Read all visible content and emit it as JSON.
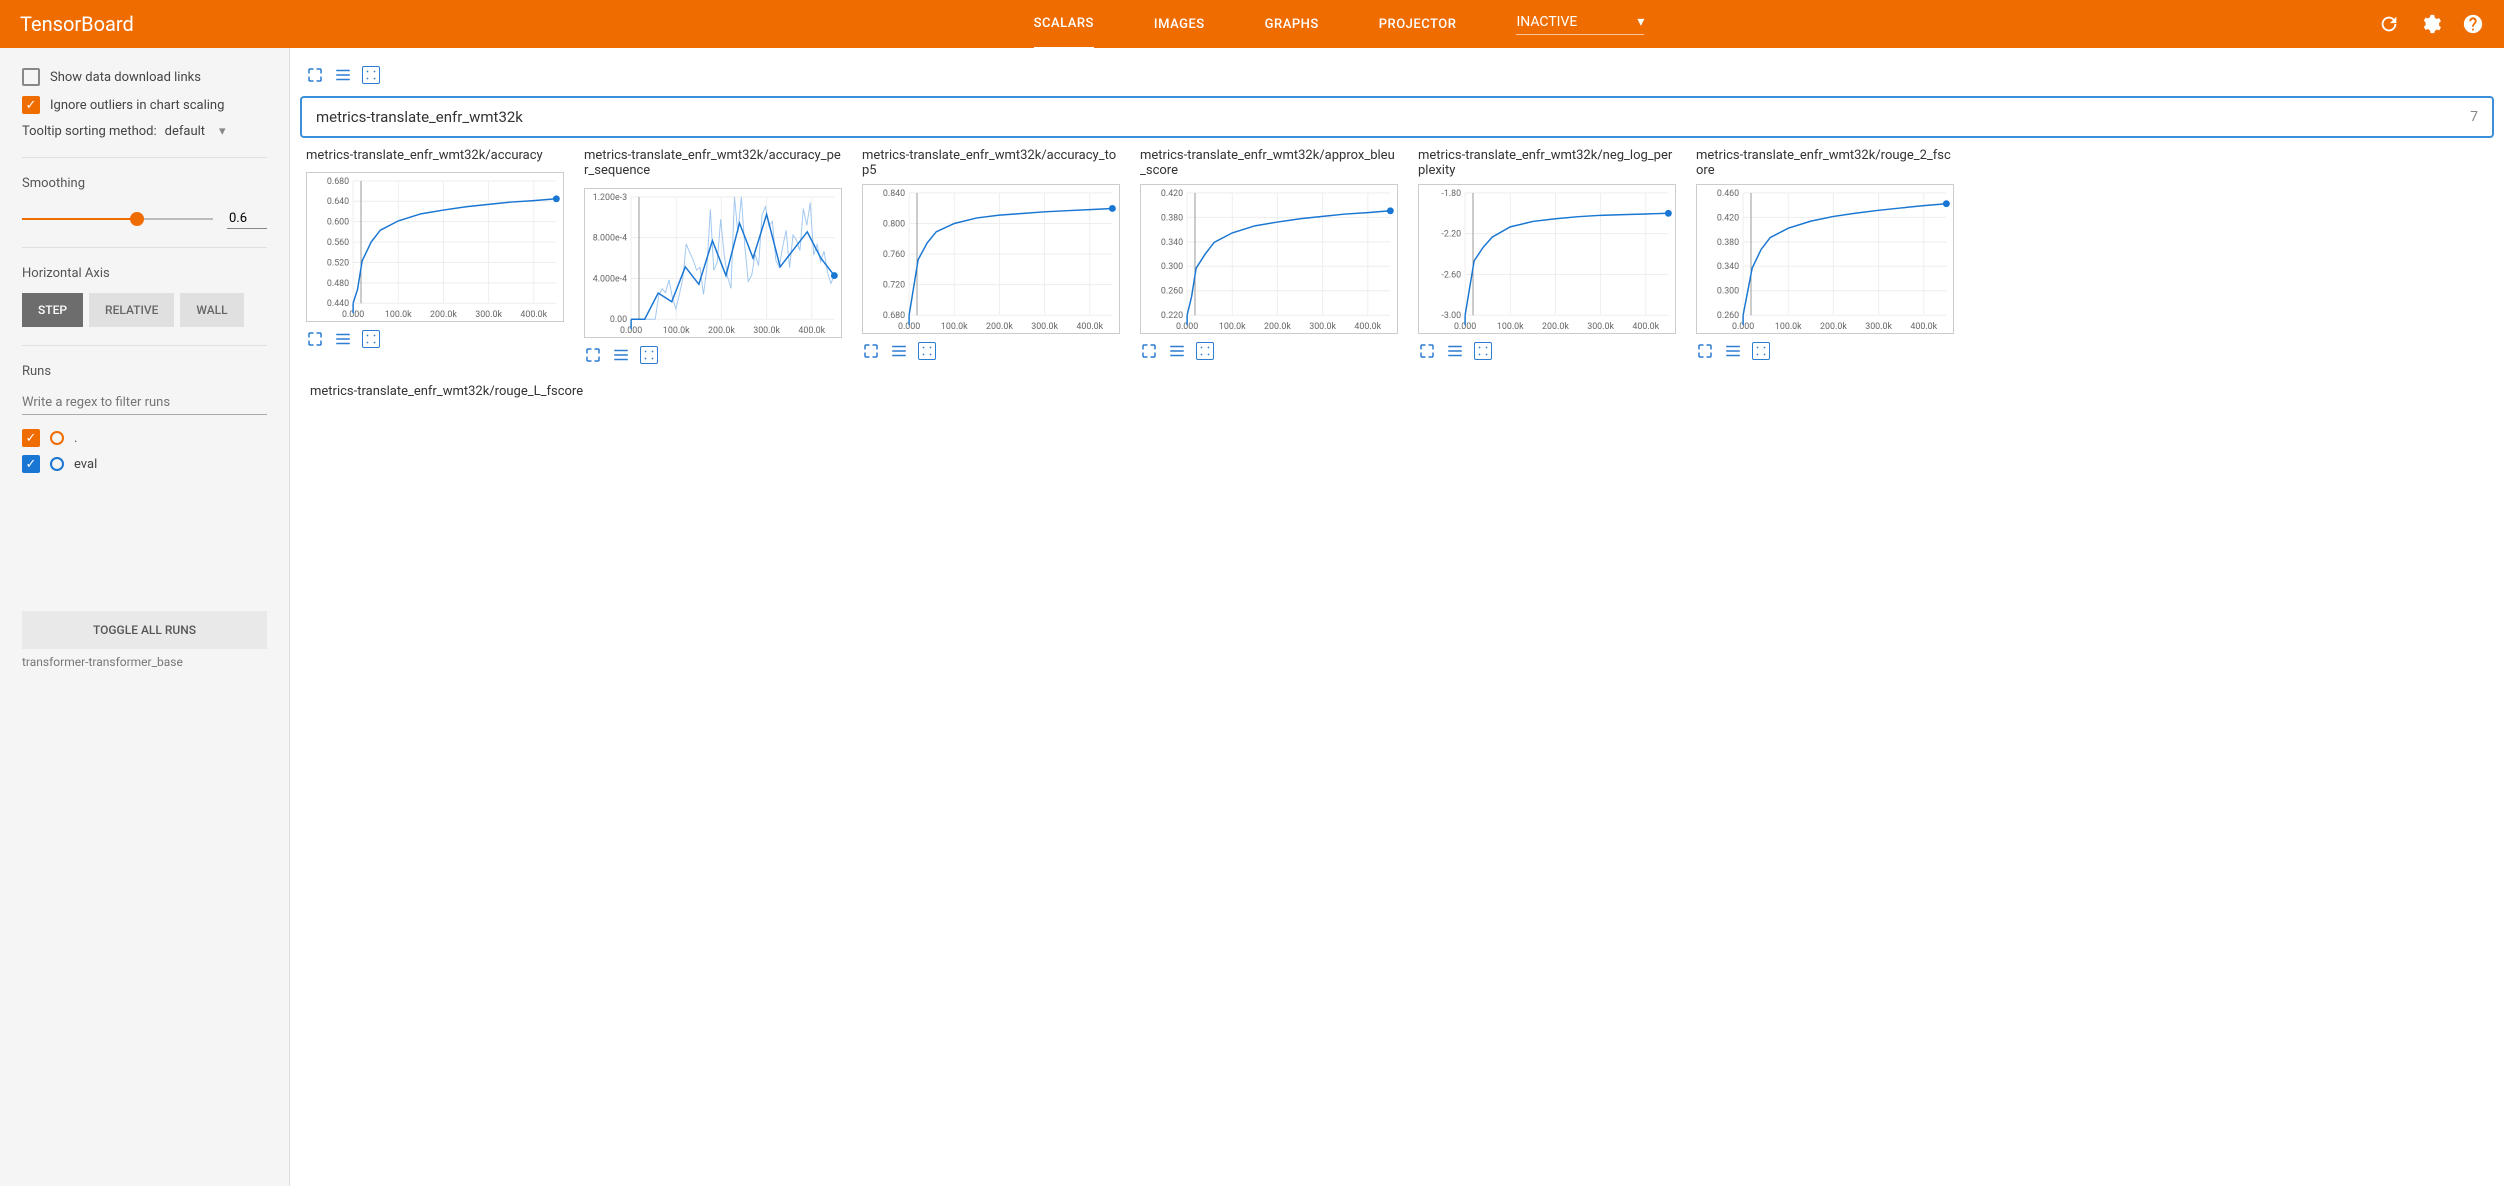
{
  "header": {
    "logo": "TensorBoard",
    "tabs": [
      "SCALARS",
      "IMAGES",
      "GRAPHS",
      "PROJECTOR"
    ],
    "active_tab": 0,
    "inactive_label": "INACTIVE"
  },
  "sidebar": {
    "show_download": {
      "label": "Show data download links",
      "checked": false
    },
    "ignore_outliers": {
      "label": "Ignore outliers in chart scaling",
      "checked": true
    },
    "tooltip_label": "Tooltip sorting method:",
    "tooltip_value": "default",
    "smoothing_label": "Smoothing",
    "smoothing_value": "0.6",
    "horizontal_axis_label": "Horizontal Axis",
    "axis_buttons": [
      "STEP",
      "RELATIVE",
      "WALL"
    ],
    "axis_active": 0,
    "runs_label": "Runs",
    "runs_placeholder": "Write a regex to filter runs",
    "runs": [
      {
        "name": ".",
        "color": "orange"
      },
      {
        "name": "eval",
        "color": "blue"
      }
    ],
    "toggle_label": "TOGGLE ALL RUNS",
    "footer": "transformer-transformer_base"
  },
  "category": {
    "name": "metrics-translate_enfr_wmt32k",
    "count": "7"
  },
  "x_ticks": [
    "0.000",
    "100.0k",
    "200.0k",
    "300.0k",
    "400.0k"
  ],
  "residual_chart_title": "metrics-translate_enfr_wmt32k/rouge_L_fscore",
  "chart_data": [
    {
      "title": "metrics-translate_enfr_wmt32k/accuracy",
      "type": "line",
      "two": false,
      "y_ticks": [
        "0.680",
        "0.640",
        "0.600",
        "0.560",
        "0.520",
        "0.480",
        "0.440"
      ],
      "x": [
        0,
        10,
        20,
        40,
        60,
        100,
        150,
        200,
        250,
        300,
        350,
        400,
        450
      ],
      "y": [
        0.43,
        0.46,
        0.52,
        0.56,
        0.585,
        0.605,
        0.62,
        0.628,
        0.635,
        0.64,
        0.645,
        0.648,
        0.652
      ],
      "ylim": [
        0.43,
        0.69
      ]
    },
    {
      "title": "metrics-translate_enfr_wmt32k/accuracy_per_sequence",
      "type": "line-noisy",
      "two": true,
      "y_ticks": [
        "1.200e-3",
        "8.000e-4",
        "4.000e-4",
        "0.00"
      ],
      "x": [
        0,
        30,
        60,
        90,
        120,
        150,
        180,
        210,
        240,
        270,
        300,
        330,
        360,
        390,
        420,
        450
      ],
      "y": [
        0,
        0,
        0.0003,
        0.0002,
        0.0006,
        0.0004,
        0.0009,
        0.0005,
        0.0011,
        0.0007,
        0.0012,
        0.0006,
        0.0008,
        0.001,
        0.0007,
        0.0005
      ],
      "ylim": [
        0,
        0.0014
      ]
    },
    {
      "title": "metrics-translate_enfr_wmt32k/accuracy_top5",
      "type": "line",
      "two": false,
      "y_ticks": [
        "0.840",
        "0.800",
        "0.760",
        "0.720",
        "0.680"
      ],
      "x": [
        0,
        10,
        20,
        40,
        60,
        100,
        150,
        200,
        250,
        300,
        350,
        400,
        450
      ],
      "y": [
        0.64,
        0.69,
        0.74,
        0.77,
        0.79,
        0.805,
        0.815,
        0.82,
        0.823,
        0.826,
        0.828,
        0.83,
        0.832
      ],
      "ylim": [
        0.64,
        0.86
      ]
    },
    {
      "title": "metrics-translate_enfr_wmt32k/approx_bleu_score",
      "type": "line",
      "two": false,
      "y_ticks": [
        "0.420",
        "0.380",
        "0.340",
        "0.300",
        "0.260",
        "0.220"
      ],
      "x": [
        0,
        10,
        20,
        40,
        60,
        100,
        150,
        200,
        250,
        300,
        350,
        400,
        450
      ],
      "y": [
        0.18,
        0.22,
        0.28,
        0.31,
        0.335,
        0.355,
        0.37,
        0.378,
        0.385,
        0.39,
        0.395,
        0.398,
        0.402
      ],
      "ylim": [
        0.18,
        0.44
      ]
    },
    {
      "title": "metrics-translate_enfr_wmt32k/neg_log_perplexity",
      "type": "line",
      "two": false,
      "y_ticks": [
        "-1.80",
        "-2.20",
        "-2.60",
        "-3.00"
      ],
      "x": [
        0,
        10,
        20,
        40,
        60,
        100,
        150,
        200,
        250,
        300,
        350,
        400,
        450
      ],
      "y": [
        -3.4,
        -3.0,
        -2.6,
        -2.4,
        -2.25,
        -2.1,
        -2.02,
        -1.98,
        -1.95,
        -1.93,
        -1.92,
        -1.91,
        -1.9
      ],
      "ylim": [
        -3.4,
        -1.6
      ]
    },
    {
      "title": "metrics-translate_enfr_wmt32k/rouge_2_fscore",
      "type": "line",
      "two": false,
      "y_ticks": [
        "0.460",
        "0.420",
        "0.380",
        "0.340",
        "0.300",
        "0.260"
      ],
      "x": [
        0,
        10,
        20,
        40,
        60,
        100,
        150,
        200,
        250,
        300,
        350,
        400,
        450
      ],
      "y": [
        0.22,
        0.27,
        0.32,
        0.36,
        0.385,
        0.405,
        0.42,
        0.43,
        0.437,
        0.443,
        0.448,
        0.453,
        0.457
      ],
      "ylim": [
        0.22,
        0.48
      ]
    }
  ]
}
